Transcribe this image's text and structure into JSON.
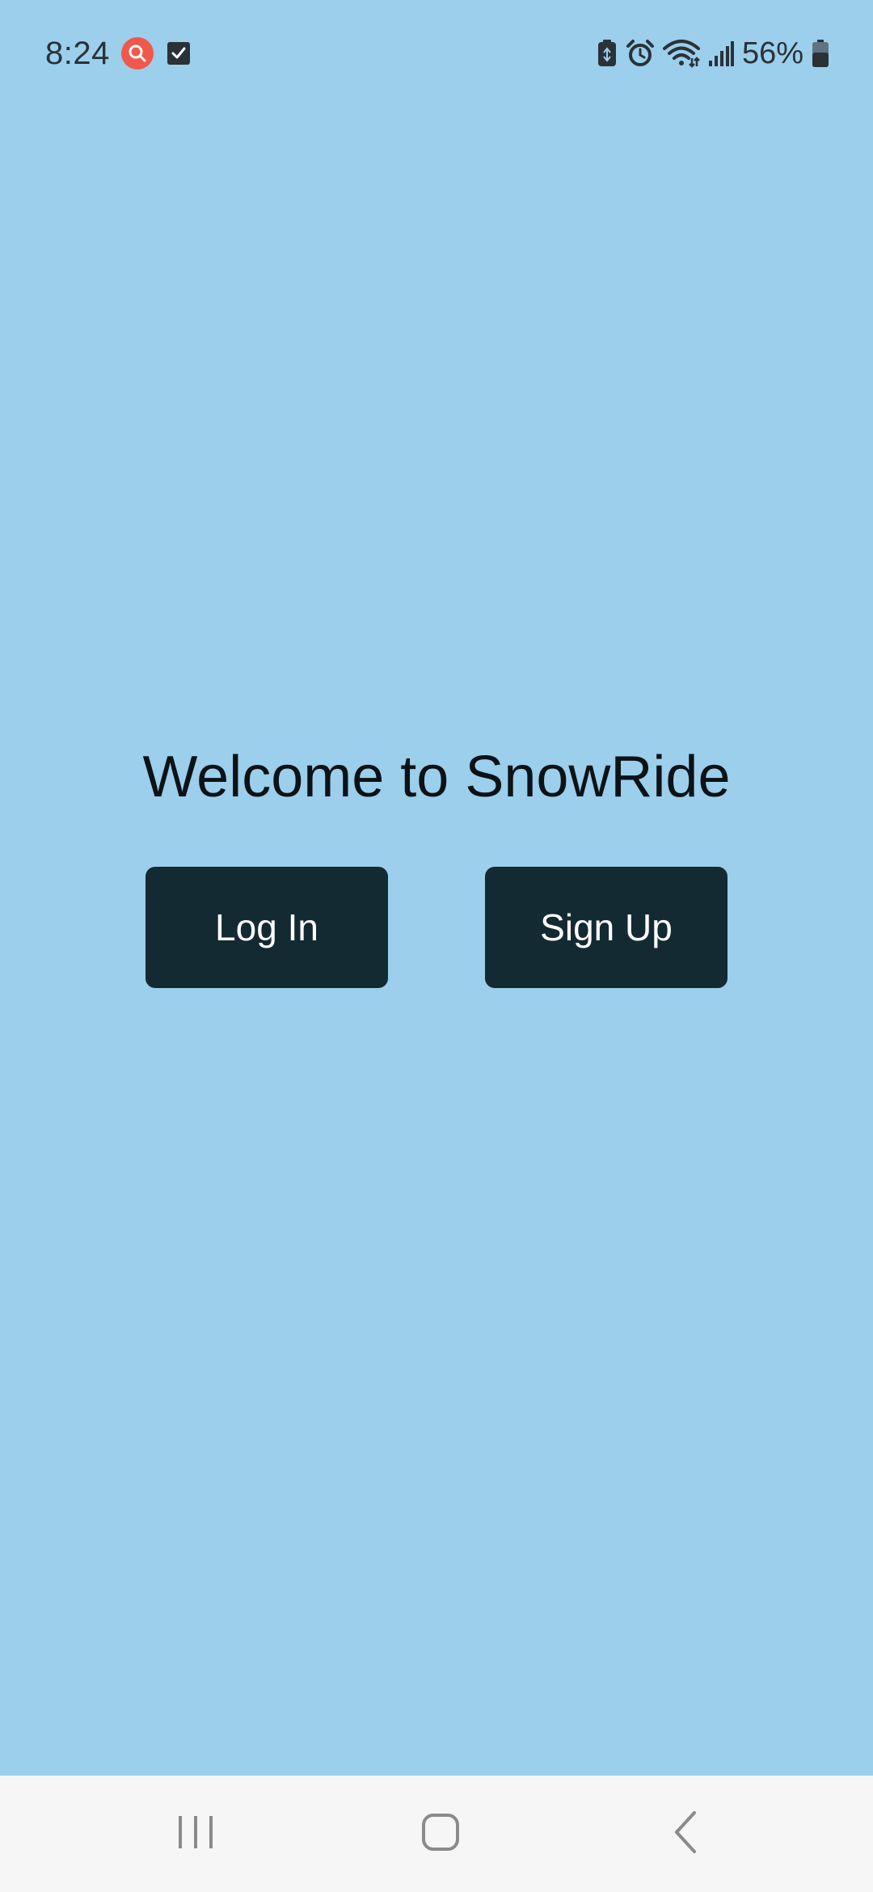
{
  "status_bar": {
    "time": "8:24",
    "battery_percent": "56%",
    "icons": [
      "search-notification-icon",
      "task-check-icon",
      "battery-saver-icon",
      "alarm-icon",
      "wifi-icon",
      "signal-icon",
      "battery-icon"
    ]
  },
  "main": {
    "title": "Welcome to SnowRide",
    "login_label": "Log In",
    "signup_label": "Sign Up"
  },
  "nav_bar": {
    "icons": [
      "recents-icon",
      "home-icon",
      "back-icon"
    ]
  },
  "colors": {
    "background": "#9bcfec",
    "button": "#142a33",
    "button_text": "#ffffff",
    "nav_background": "#f6f6f6"
  }
}
